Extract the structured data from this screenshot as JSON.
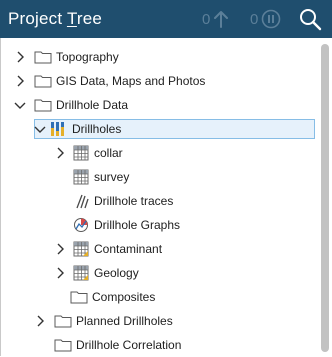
{
  "header": {
    "title_prefix": "Project ",
    "title_underlined": "T",
    "title_suffix": "ree",
    "upload_count": "0",
    "pause_count": "0",
    "bg_color": "#1f4e6e"
  },
  "tree": {
    "topography": "Topography",
    "gis": "GIS Data, Maps and Photos",
    "drillhole_data": "Drillhole Data",
    "drillholes": "Drillholes",
    "collar": "collar",
    "survey": "survey",
    "traces": "Drillhole traces",
    "graphs": "Drillhole Graphs",
    "contaminant": "Contaminant",
    "geology": "Geology",
    "composites": "Composites",
    "planned": "Planned Drillholes",
    "correlation": "Drillhole Correlation"
  },
  "selection_color": "#86bde6"
}
